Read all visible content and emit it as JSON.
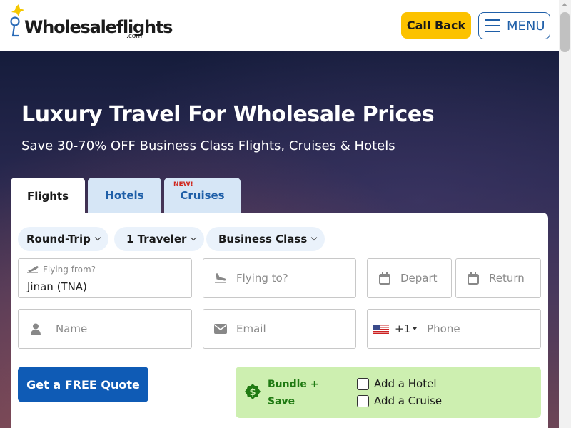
{
  "header": {
    "logo_text": "Wholesaleflights",
    "logo_suffix": ".com",
    "call_back_label": "Call Back",
    "menu_label": "MENU"
  },
  "hero": {
    "title": "Luxury Travel For Wholesale Prices",
    "subtitle": "Save 30-70% OFF Business Class Flights, Cruises & Hotels"
  },
  "tabs": {
    "flights": "Flights",
    "hotels": "Hotels",
    "cruises": "Cruises",
    "cruises_badge": "NEW!"
  },
  "options": {
    "trip_type": "Round-Trip",
    "travelers": "1 Traveler",
    "cabin_class": "Business Class"
  },
  "form": {
    "from_label": "Flying from?",
    "from_value": "Jinan (TNA)",
    "to_placeholder": "Flying to?",
    "depart_placeholder": "Depart",
    "return_placeholder": "Return",
    "name_placeholder": "Name",
    "email_placeholder": "Email",
    "phone_code": "+1",
    "phone_placeholder": "Phone",
    "submit_label": "Get a FREE Quote"
  },
  "bundle": {
    "label": "Bundle + Save",
    "option_hotel": "Add a Hotel",
    "option_cruise": "Add a Cruise"
  },
  "icons": {
    "plane_departure": "plane-departure-icon",
    "plane_arrival": "plane-arrival-icon",
    "calendar": "calendar-icon",
    "user": "user-icon",
    "envelope": "envelope-icon",
    "us_flag": "us-flag-icon",
    "dollar_badge": "dollar-badge-icon",
    "hamburger": "hamburger-icon"
  },
  "colors": {
    "call_back_bg": "#fcc200",
    "primary_blue": "#0f5bb5",
    "tab_inactive_bg": "#d6e6f6",
    "bundle_bg": "#cdefb0",
    "bundle_text": "#1f7a12",
    "new_badge": "#d0281f"
  }
}
